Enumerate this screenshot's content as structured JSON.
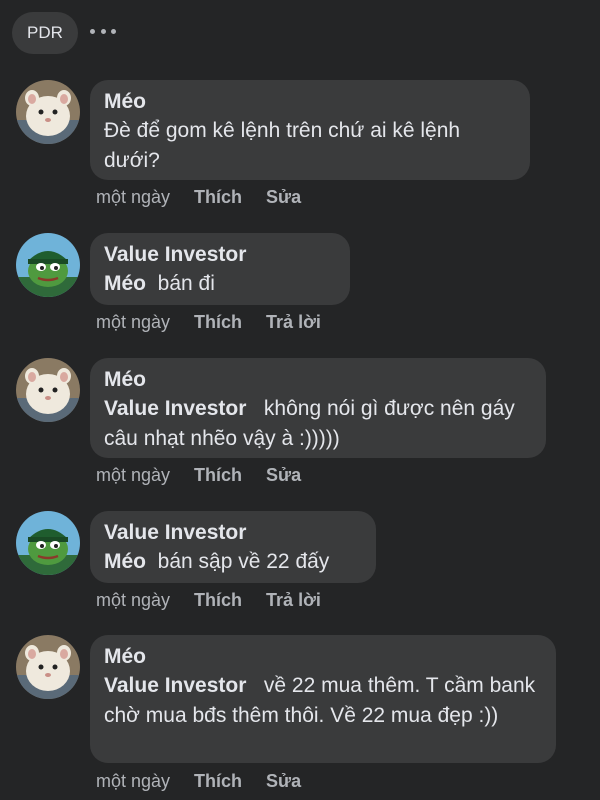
{
  "header": {
    "tag": "PDR"
  },
  "comments": [
    {
      "author": "Méo",
      "mention": "",
      "text": "Đè để gom kê lệnh trên chứ ai kê lệnh dưới?",
      "time": "một ngày",
      "like": "Thích",
      "action": "Sửa"
    },
    {
      "author": "Value Investor",
      "mention": "Méo",
      "text": "bán đi",
      "time": "một ngày",
      "like": "Thích",
      "action": "Trả lời"
    },
    {
      "author": "Méo",
      "mention": "Value Investor",
      "text": "không nói gì được nên gáy câu nhạt nhẽo vậy à :)))))",
      "time": "một ngày",
      "like": "Thích",
      "action": "Sửa"
    },
    {
      "author": "Value Investor",
      "mention": "Méo",
      "text": "bán sập về 22 đấy",
      "time": "một ngày",
      "like": "Thích",
      "action": "Trả lời"
    },
    {
      "author": "Méo",
      "mention": "Value Investor",
      "text": "về 22 mua thêm. T cầm bank chờ mua bđs thêm thôi. Về 22 mua đẹp :))",
      "time": "một ngày",
      "like": "Thích",
      "action": "Sửa"
    }
  ]
}
